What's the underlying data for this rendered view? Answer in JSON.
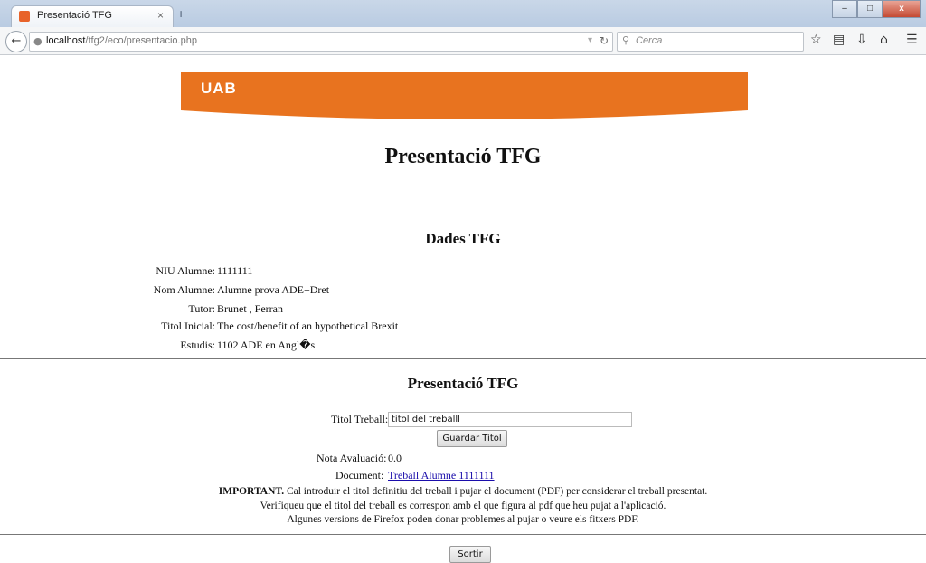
{
  "browser": {
    "tab_title": "Presentació TFG",
    "tab_close": "×",
    "new_tab": "+",
    "url_host": "localhost",
    "url_path": "/tfg2/eco/presentacio.php",
    "search_placeholder": "Cerca",
    "window_buttons": [
      "–",
      "□",
      "x"
    ]
  },
  "banner": {
    "logo_text": "UAB",
    "color": "#e8731f"
  },
  "page_title": "Presentació TFG",
  "dades": {
    "heading": "Dades TFG",
    "rows": [
      {
        "label": "NIU Alumne:",
        "value": "1111111"
      },
      {
        "label": "Nom Alumne:",
        "value": "Alumne prova ADE+Dret"
      },
      {
        "label": "Tutor:",
        "value": "Brunet , Ferran"
      },
      {
        "label": "Titol Inicial:",
        "value": "The cost/benefit of an hypothetical Brexit"
      },
      {
        "label": "Estudis:",
        "value": "1102 ADE en Angl�s"
      }
    ]
  },
  "presentacio": {
    "heading": "Presentació TFG",
    "titol_label": "Titol Treball:",
    "titol_value": "titol del treballl",
    "save_button": "Guardar Titol",
    "nota_label": "Nota Avaluació:",
    "nota_value": "0.0",
    "document_label": "Document:",
    "document_link": "Treball Alumne 1111111",
    "important_bold": "IMPORTANT.",
    "important_text": " Cal introduir el titol definitiu del treball i pujar el document (PDF) per considerar el treball presentat.",
    "notice_2": "Verifiqueu que el titol del treball es correspon amb el que figura al pdf que heu pujat a l'aplicació.",
    "notice_3": "Algunes versions de Firefox poden donar problemes al pujar o veure els fitxers PDF."
  },
  "exit_button": "Sortir"
}
